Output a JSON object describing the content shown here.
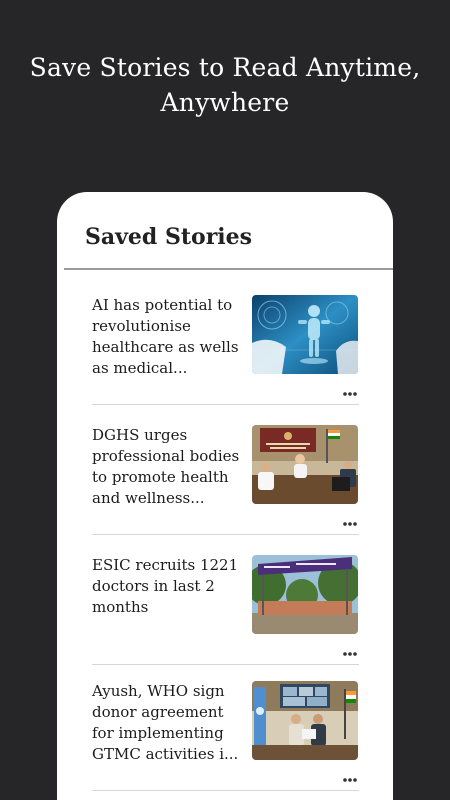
{
  "promo": {
    "title_line1": "Save Stories to Read Anytime,",
    "title_line2": "Anywhere"
  },
  "screen": {
    "title": "Saved Stories"
  },
  "stories": [
    {
      "headline": "AI has potential to revolutionise healthcare as wells as medical...",
      "thumbnail": "ai-healthcare-hologram",
      "menu_icon": "more-horizontal-icon"
    },
    {
      "headline": "DGHS urges professional bodies to promote health and wellness...",
      "thumbnail": "dghs-meeting-room",
      "menu_icon": "more-horizontal-icon"
    },
    {
      "headline": "ESIC recruits 1221 doctors in last 2 months",
      "thumbnail": "esic-building-signboard",
      "menu_icon": "more-horizontal-icon"
    },
    {
      "headline": "Ayush, WHO sign donor agreement for implementing GTMC activities i...",
      "thumbnail": "ayush-who-signing",
      "menu_icon": "more-horizontal-icon"
    }
  ],
  "colors": {
    "background": "#262628",
    "card": "#ffffff",
    "text": "#1c1c1c"
  }
}
